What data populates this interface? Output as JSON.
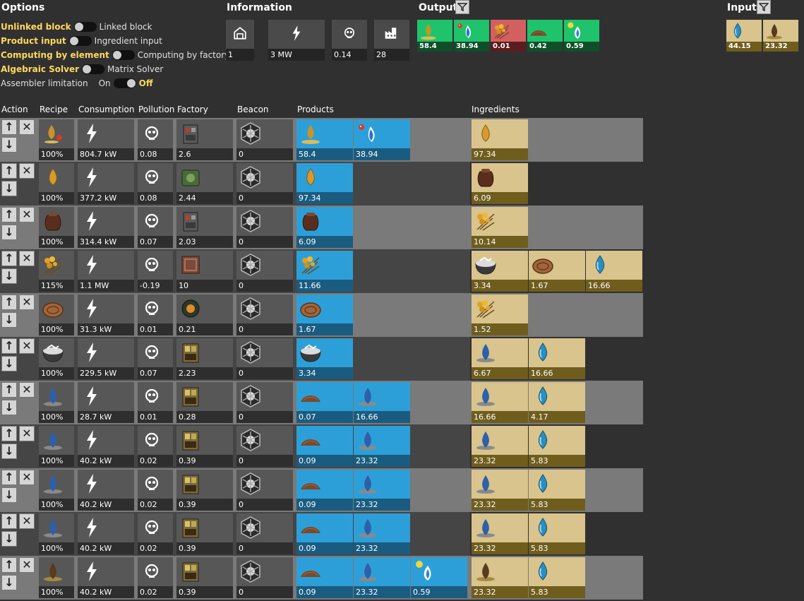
{
  "options": {
    "title": "Options",
    "rows": [
      {
        "left": "Unlinked block",
        "right": "Linked block",
        "state": "left"
      },
      {
        "left": "Product input",
        "right": "Ingredient input",
        "state": "left"
      },
      {
        "left": "Computing by element",
        "right": "Computing by factory",
        "state": "left"
      },
      {
        "left": "Algebraic Solver",
        "right": "Matrix Solver",
        "state": "left"
      }
    ],
    "assembler": {
      "label": "Assembler limitation",
      "on": "On",
      "off": "Off",
      "state": "off"
    }
  },
  "information": {
    "title": "Information",
    "cells": [
      {
        "icon": "block-icon",
        "value": "1"
      },
      {
        "icon": "power-icon",
        "value": "3 MW"
      },
      {
        "icon": "pollution-icon",
        "value": "0.14"
      },
      {
        "icon": "factory-icon",
        "value": "28"
      }
    ]
  },
  "output": {
    "title": "Output",
    "items": [
      {
        "icon": "seed-icon",
        "value": "58.4",
        "color": "green"
      },
      {
        "icon": "gas-fire-icon",
        "value": "38.94",
        "color": "green"
      },
      {
        "icon": "plant-icon",
        "value": "0.01",
        "color": "red"
      },
      {
        "icon": "soil-icon",
        "value": "0.42",
        "color": "green"
      },
      {
        "icon": "fuel-icon",
        "value": "0.59",
        "color": "green"
      }
    ]
  },
  "input": {
    "title": "Input",
    "items": [
      {
        "icon": "water-drop-icon",
        "value": "44.15"
      },
      {
        "icon": "mud-drop-icon",
        "value": "23.32"
      }
    ]
  },
  "columns": {
    "action": "Action",
    "recipe": "Recipe",
    "consumption": "Consumption",
    "pollution": "Pollution",
    "factory": "Factory",
    "beacon": "Beacon",
    "products": "Products",
    "ingredients": "Ingredients"
  },
  "rows": [
    {
      "recipe": "100%",
      "consumption": "804.7 kW",
      "pollution": "0.08",
      "factory": "2.6",
      "beacon": "0",
      "products": [
        {
          "icon": "seed-icon",
          "value": "58.4"
        },
        {
          "icon": "gas-fire-icon",
          "value": "38.94"
        }
      ],
      "ingredients": [
        {
          "icon": "seed-drop-icon",
          "value": "97.34"
        }
      ]
    },
    {
      "recipe": "100%",
      "consumption": "377.2 kW",
      "pollution": "0.08",
      "factory": "2.44",
      "beacon": "0",
      "products": [
        {
          "icon": "seed-drop-icon",
          "value": "97.34"
        }
      ],
      "ingredients": [
        {
          "icon": "sack-icon",
          "value": "6.09"
        }
      ]
    },
    {
      "recipe": "100%",
      "consumption": "314.4 kW",
      "pollution": "0.07",
      "factory": "2.03",
      "beacon": "0",
      "products": [
        {
          "icon": "sack-icon",
          "value": "6.09"
        }
      ],
      "ingredients": [
        {
          "icon": "plant-icon",
          "value": "10.14"
        }
      ]
    },
    {
      "recipe": "115%",
      "consumption": "1.1 MW",
      "pollution": "-0.19",
      "factory": "10",
      "beacon": "0",
      "products": [
        {
          "icon": "plant-icon",
          "value": "11.66"
        }
      ],
      "ingredients": [
        {
          "icon": "bowl-icon",
          "value": "3.34"
        },
        {
          "icon": "clay-icon",
          "value": "1.67"
        },
        {
          "icon": "water-drop-icon",
          "value": "16.66"
        }
      ]
    },
    {
      "recipe": "100%",
      "consumption": "31.3 kW",
      "pollution": "0.01",
      "factory": "0.21",
      "beacon": "0",
      "products": [
        {
          "icon": "clay-icon",
          "value": "1.67"
        }
      ],
      "ingredients": [
        {
          "icon": "plant-icon",
          "value": "1.52"
        }
      ]
    },
    {
      "recipe": "100%",
      "consumption": "229.5 kW",
      "pollution": "0.07",
      "factory": "2.23",
      "beacon": "0",
      "products": [
        {
          "icon": "bowl-icon",
          "value": "3.34"
        }
      ],
      "ingredients": [
        {
          "icon": "water-puddle-icon",
          "value": "6.67"
        },
        {
          "icon": "water-drop-icon",
          "value": "16.66"
        }
      ]
    },
    {
      "recipe": "100%",
      "consumption": "28.7 kW",
      "pollution": "0.01",
      "factory": "0.28",
      "beacon": "0",
      "products": [
        {
          "icon": "soil-icon",
          "value": "0.07"
        },
        {
          "icon": "water-puddle-icon",
          "value": "16.66"
        }
      ],
      "ingredients": [
        {
          "icon": "water-puddle-icon",
          "value": "16.66"
        },
        {
          "icon": "water-drop-icon",
          "value": "4.17"
        }
      ]
    },
    {
      "recipe": "100%",
      "consumption": "40.2 kW",
      "pollution": "0.02",
      "factory": "0.39",
      "beacon": "0",
      "products": [
        {
          "icon": "soil-icon",
          "value": "0.09"
        },
        {
          "icon": "water-puddle-icon",
          "value": "23.32"
        }
      ],
      "ingredients": [
        {
          "icon": "water-puddle-icon",
          "value": "23.32"
        },
        {
          "icon": "water-drop-icon",
          "value": "5.83"
        }
      ]
    },
    {
      "recipe": "100%",
      "consumption": "40.2 kW",
      "pollution": "0.02",
      "factory": "0.39",
      "beacon": "0",
      "products": [
        {
          "icon": "soil-icon",
          "value": "0.09"
        },
        {
          "icon": "water-puddle-icon",
          "value": "23.32"
        }
      ],
      "ingredients": [
        {
          "icon": "water-puddle-icon",
          "value": "23.32"
        },
        {
          "icon": "water-drop-icon",
          "value": "5.83"
        }
      ]
    },
    {
      "recipe": "100%",
      "consumption": "40.2 kW",
      "pollution": "0.02",
      "factory": "0.39",
      "beacon": "0",
      "products": [
        {
          "icon": "soil-icon",
          "value": "0.09"
        },
        {
          "icon": "water-puddle-icon",
          "value": "23.32"
        }
      ],
      "ingredients": [
        {
          "icon": "water-puddle-icon",
          "value": "23.32"
        },
        {
          "icon": "water-drop-icon",
          "value": "5.83"
        }
      ]
    },
    {
      "recipe": "100%",
      "consumption": "40.2 kW",
      "pollution": "0.02",
      "factory": "0.39",
      "beacon": "0",
      "products": [
        {
          "icon": "soil-icon",
          "value": "0.09"
        },
        {
          "icon": "water-puddle-icon",
          "value": "23.32"
        },
        {
          "icon": "fuel-icon",
          "value": "0.59"
        }
      ],
      "ingredients": [
        {
          "icon": "mud-drop-icon",
          "value": "23.32"
        },
        {
          "icon": "water-drop-icon",
          "value": "5.83"
        }
      ]
    }
  ]
}
